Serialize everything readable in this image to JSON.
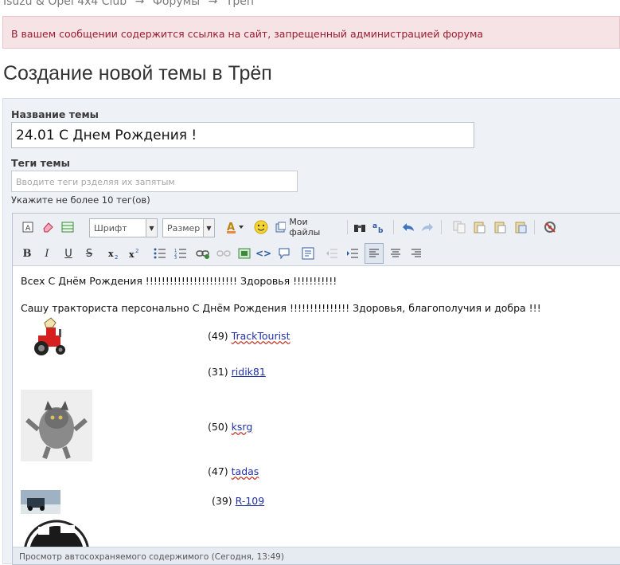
{
  "breadcrumb": {
    "items": [
      "Isuzu & Opel 4x4 Club",
      "→",
      "Форумы",
      "→",
      "Трёп"
    ]
  },
  "error": {
    "message": "В вашем сообщении содержится ссылка на сайт, запрещенный администрацией форума"
  },
  "page": {
    "title": "Создание новой темы в Трёп"
  },
  "form": {
    "title_label": "Название темы",
    "title_value": "24.01 С Днем Рождения !",
    "tags_label": "Теги темы",
    "tags_placeholder": "Вводите теги рзделяя их запятым",
    "tags_hint": "Укажите не более 10 тег(ов)"
  },
  "toolbar": {
    "font_select": "Шрифт",
    "size_select": "Размер",
    "my_files": "Мои файлы",
    "bold": "B",
    "italic": "I",
    "underline": "U",
    "strike": "S"
  },
  "post": {
    "line1": "Всех С Днём Рождения !!!!!!!!!!!!!!!!!!!!!!!  Здоровья !!!!!!!!!!!",
    "line2": "Сашу тракториста персонально С Днём Рождения !!!!!!!!!!!!!!! Здоровья, благополучия и  добра !!!",
    "users": [
      {
        "count": "(49)",
        "name": "TrackTourist"
      },
      {
        "count": "(31)",
        "name": "ridik81"
      },
      {
        "count": "(50)",
        "name": "ksrg"
      },
      {
        "count": "(47)",
        "name": "tadas"
      },
      {
        "count": "(39)",
        "name": "R-109"
      }
    ]
  },
  "status": {
    "autosave": "Просмотр автосохраняемого содержимого (Сегодня, 13:49)"
  },
  "colors": {
    "error_bg": "#f6e3e6",
    "error_text": "#9a1b2e",
    "link": "#1f2fa8",
    "panel_bg": "#eef2f7"
  }
}
